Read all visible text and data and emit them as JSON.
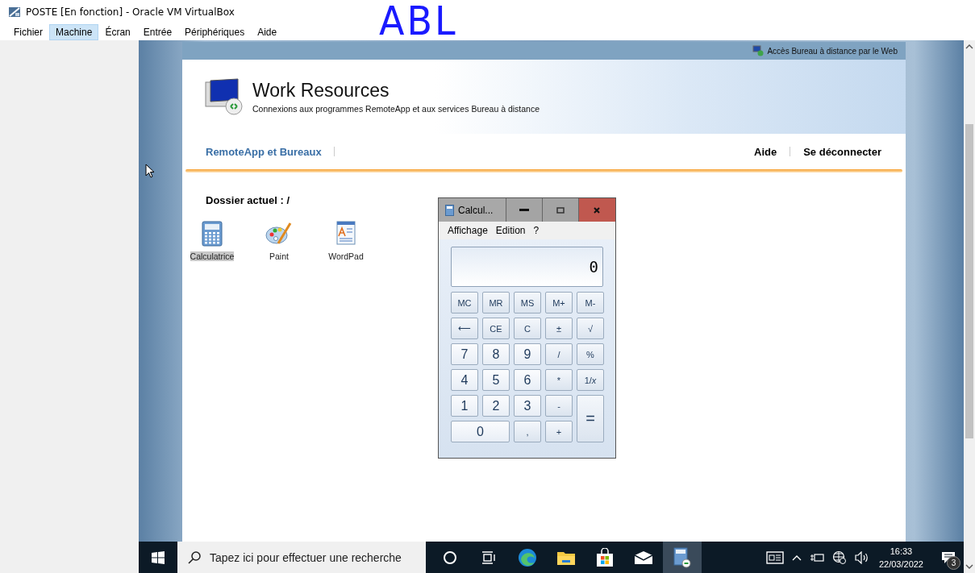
{
  "window": {
    "title": "POSTE [En fonction] - Oracle VM VirtualBox"
  },
  "menu": [
    {
      "label": "Fichier",
      "selected": false
    },
    {
      "label": "Machine",
      "selected": true
    },
    {
      "label": "Écran",
      "selected": false
    },
    {
      "label": "Entrée",
      "selected": false
    },
    {
      "label": "Périphériques",
      "selected": false
    },
    {
      "label": "Aide",
      "selected": false
    }
  ],
  "annotation": "ABL",
  "web": {
    "top_link": "Accès Bureau à distance par le Web",
    "title": "Work Resources",
    "subtitle": "Connexions aux programmes RemoteApp et aux services Bureau à distance",
    "nav": [
      "RemoteApp et Bureaux"
    ],
    "right_nav": [
      "Aide",
      "Se déconnecter"
    ],
    "folder_label": "Dossier actuel : /",
    "apps": [
      {
        "label": "Calculatrice",
        "kind": "calculator",
        "selected": true
      },
      {
        "label": "Paint",
        "kind": "paint",
        "selected": false
      },
      {
        "label": "WordPad",
        "kind": "wordpad",
        "selected": false
      }
    ]
  },
  "calculator": {
    "title": "Calcul...",
    "menu": [
      "Affichage",
      "Edition",
      "?"
    ],
    "display": "0",
    "keys": [
      {
        "label": "MC",
        "kind": "memory"
      },
      {
        "label": "MR",
        "kind": "memory"
      },
      {
        "label": "MS",
        "kind": "memory"
      },
      {
        "label": "M+",
        "kind": "memory"
      },
      {
        "label": "M-",
        "kind": "memory"
      },
      {
        "label": "⟵",
        "kind": "op"
      },
      {
        "label": "CE",
        "kind": "op"
      },
      {
        "label": "C",
        "kind": "op"
      },
      {
        "label": "±",
        "kind": "op"
      },
      {
        "label": "√",
        "kind": "op"
      },
      {
        "label": "7",
        "kind": "digit"
      },
      {
        "label": "8",
        "kind": "digit"
      },
      {
        "label": "9",
        "kind": "digit"
      },
      {
        "label": "/",
        "kind": "op"
      },
      {
        "label": "%",
        "kind": "op"
      },
      {
        "label": "4",
        "kind": "digit"
      },
      {
        "label": "5",
        "kind": "digit"
      },
      {
        "label": "6",
        "kind": "digit"
      },
      {
        "label": "*",
        "kind": "op"
      },
      {
        "label": "1/*x*",
        "kind": "op"
      },
      {
        "label": "1",
        "kind": "digit"
      },
      {
        "label": "2",
        "kind": "digit"
      },
      {
        "label": "3",
        "kind": "digit"
      },
      {
        "label": "-",
        "kind": "op"
      },
      {
        "label": "=",
        "kind": "tall"
      },
      {
        "label": "0",
        "kind": "wide"
      },
      {
        "label": ",",
        "kind": "op"
      },
      {
        "label": "+",
        "kind": "op"
      }
    ]
  },
  "taskbar": {
    "search_placeholder": "Tapez ici pour effectuer une recherche",
    "apps": [
      {
        "kind": "cortana",
        "active": false
      },
      {
        "kind": "taskview",
        "active": false
      },
      {
        "kind": "edge",
        "active": false
      },
      {
        "kind": "explorer",
        "active": false
      },
      {
        "kind": "store",
        "active": false
      },
      {
        "kind": "mail",
        "active": false
      },
      {
        "kind": "remoteapp",
        "active": true
      }
    ],
    "time": "16:33",
    "date": "22/03/2022",
    "notifications": "3"
  }
}
